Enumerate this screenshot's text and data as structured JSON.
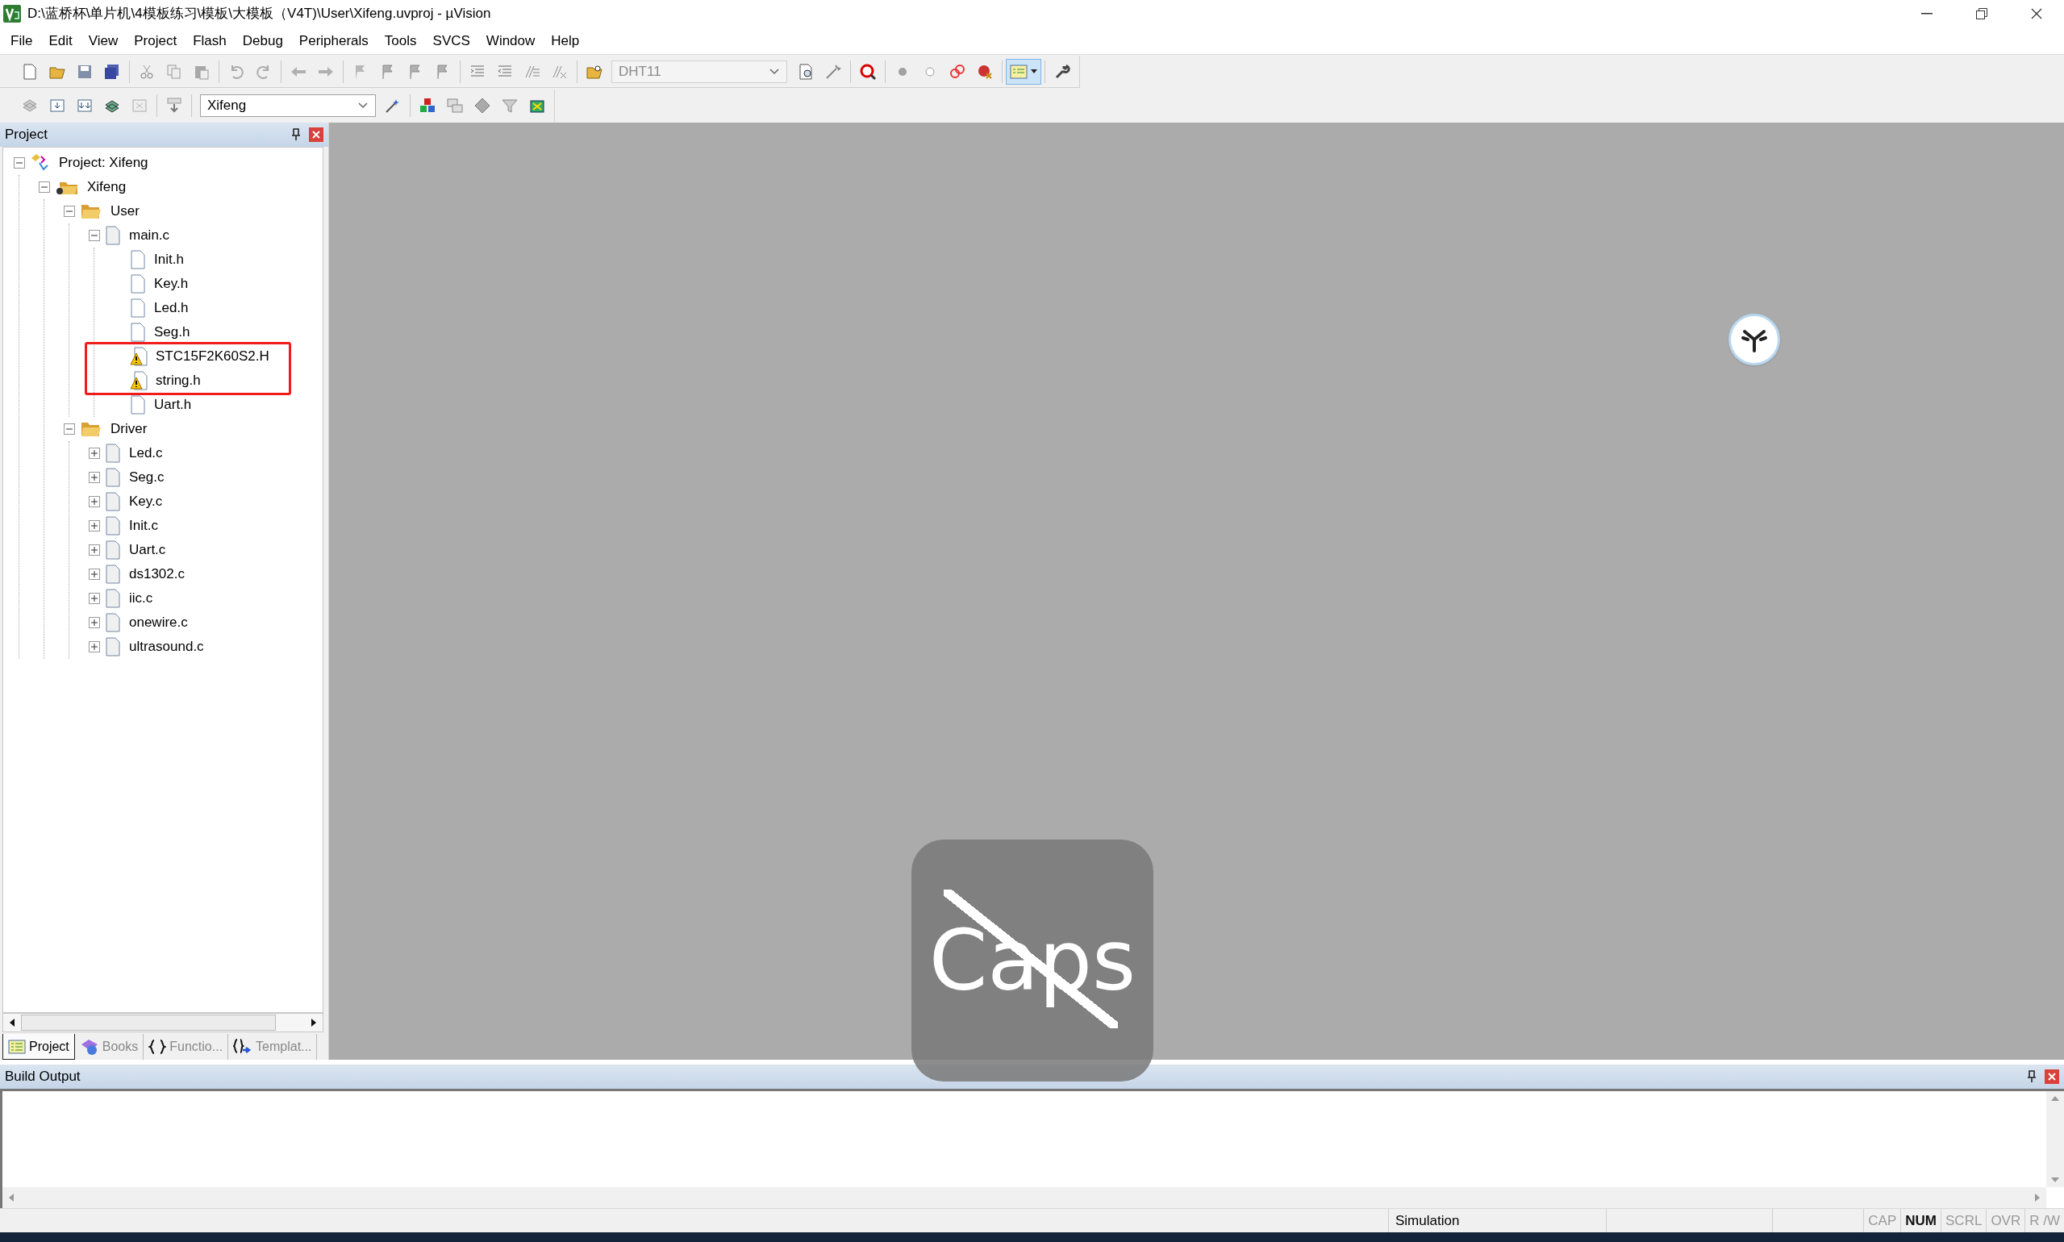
{
  "window": {
    "title": "D:\\蓝桥杯\\单片机\\4模板练习\\模板\\大模板（V4T)\\User\\Xifeng.uvproj - µVision"
  },
  "menu": [
    "File",
    "Edit",
    "View",
    "Project",
    "Flash",
    "Debug",
    "Peripherals",
    "Tools",
    "SVCS",
    "Window",
    "Help"
  ],
  "toolbar": {
    "target_dropdown": {
      "value": "DHT11",
      "disabled": true
    }
  },
  "build_toolbar": {
    "target_dropdown": {
      "value": "Xifeng",
      "disabled": false
    }
  },
  "project_panel": {
    "title": "Project",
    "tree": [
      {
        "label": "Project: Xifeng",
        "kind": "project",
        "expanded": true,
        "children": [
          {
            "label": "Xifeng",
            "kind": "target",
            "expanded": true,
            "children": [
              {
                "label": "User",
                "kind": "folder",
                "expanded": true,
                "children": [
                  {
                    "label": "main.c",
                    "kind": "source",
                    "expanded": true,
                    "children": [
                      {
                        "label": "Init.h",
                        "kind": "header",
                        "marked": false
                      },
                      {
                        "label": "Key.h",
                        "kind": "header",
                        "marked": false
                      },
                      {
                        "label": "Led.h",
                        "kind": "header",
                        "marked": false
                      },
                      {
                        "label": "Seg.h",
                        "kind": "header",
                        "marked": false
                      },
                      {
                        "label": "STC15F2K60S2.H",
                        "kind": "warning",
                        "marked": true
                      },
                      {
                        "label": "string.h",
                        "kind": "warning",
                        "marked": true
                      },
                      {
                        "label": "Uart.h",
                        "kind": "header",
                        "marked": false
                      }
                    ]
                  }
                ]
              },
              {
                "label": "Driver",
                "kind": "folder",
                "expanded": true,
                "children": [
                  {
                    "label": "Led.c",
                    "kind": "source",
                    "expanded": false
                  },
                  {
                    "label": "Seg.c",
                    "kind": "source",
                    "expanded": false
                  },
                  {
                    "label": "Key.c",
                    "kind": "source",
                    "expanded": false
                  },
                  {
                    "label": "Init.c",
                    "kind": "source",
                    "expanded": false
                  },
                  {
                    "label": "Uart.c",
                    "kind": "source",
                    "expanded": false
                  },
                  {
                    "label": "ds1302.c",
                    "kind": "source",
                    "expanded": false
                  },
                  {
                    "label": "iic.c",
                    "kind": "source",
                    "expanded": false
                  },
                  {
                    "label": "onewire.c",
                    "kind": "source",
                    "expanded": false
                  },
                  {
                    "label": "ultrasound.c",
                    "kind": "source",
                    "expanded": false
                  }
                ]
              }
            ]
          }
        ]
      }
    ],
    "tabs": [
      {
        "label": "Project",
        "kind": "project",
        "selected": true
      },
      {
        "label": "Books",
        "kind": "books",
        "selected": false
      },
      {
        "label": "Functio...",
        "kind": "functions",
        "selected": false
      },
      {
        "label": "Templat...",
        "kind": "templates",
        "selected": false
      }
    ]
  },
  "build_output": {
    "title": "Build Output"
  },
  "status_bar": {
    "mode": "Simulation",
    "indicators": [
      {
        "label": "CAP",
        "active": false
      },
      {
        "label": "NUM",
        "active": true
      },
      {
        "label": "SCRL",
        "active": false
      },
      {
        "label": "OVR",
        "active": false
      },
      {
        "label": "R /W",
        "active": false
      }
    ]
  },
  "caps_overlay": {
    "label": "Caps"
  }
}
